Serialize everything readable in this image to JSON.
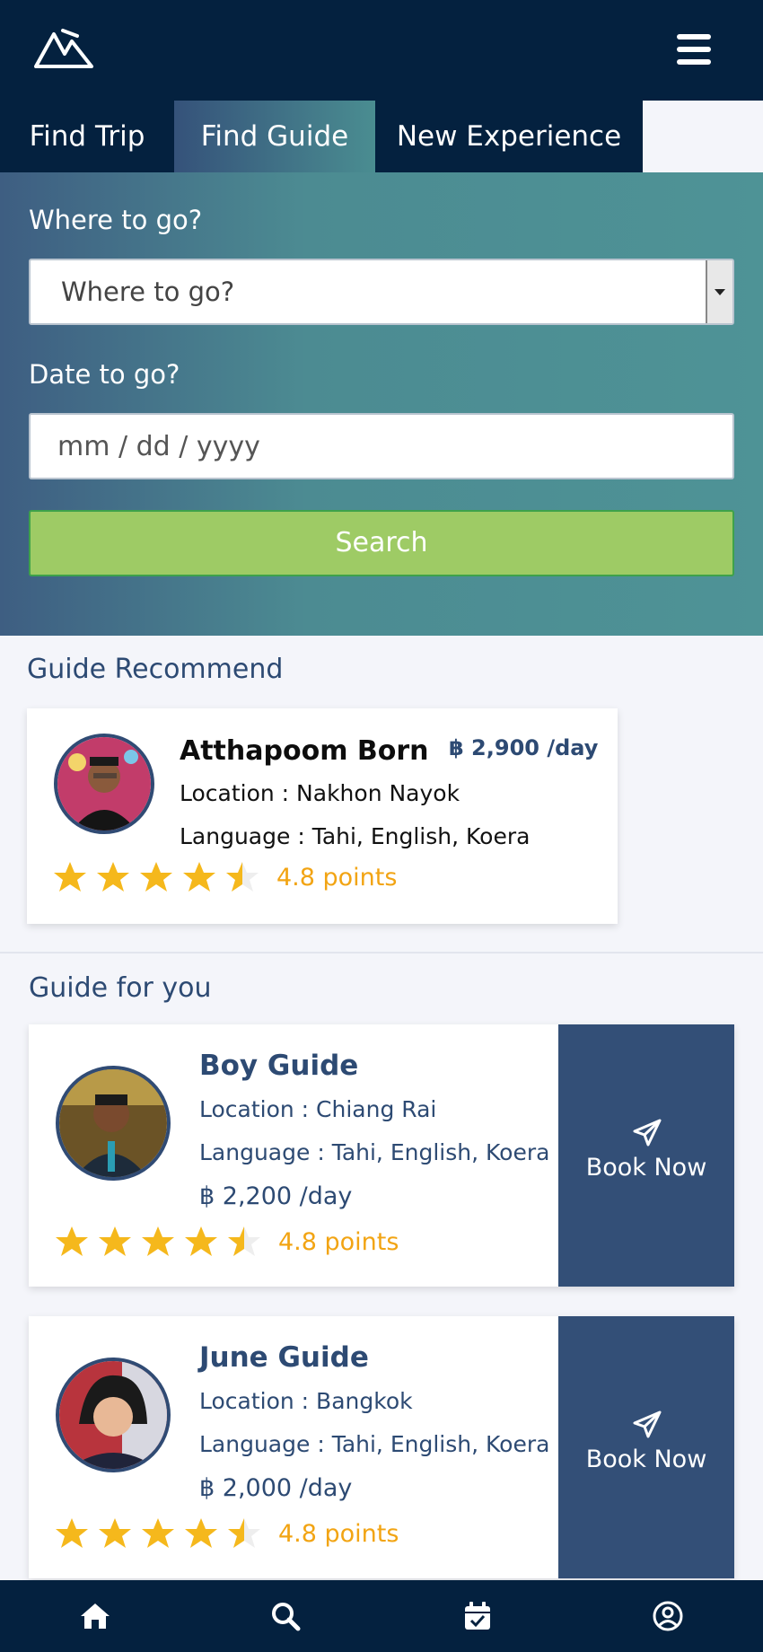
{
  "tabs": [
    {
      "label": "Find Trip",
      "active": false
    },
    {
      "label": "Find Guide",
      "active": true
    },
    {
      "label": "New Experience",
      "active": false
    }
  ],
  "search": {
    "where_label": "Where to go?",
    "where_value": "Where to go?",
    "date_label": "Date to go?",
    "date_placeholder": "mm / dd / yyyy",
    "button_label": "Search"
  },
  "recommend": {
    "title": "Guide Recommend",
    "name": "Atthapoom Born",
    "price": "฿ 2,900 /day",
    "location": "Location : Nakhon Nayok",
    "language": "Language : Tahi, English, Koera",
    "rating": 4.5,
    "points": "4.8 points"
  },
  "guides_title": "Guide for you",
  "guides": [
    {
      "name": "Boy Guide",
      "location": "Location : Chiang Rai",
      "language": "Language : Tahi, English, Koera",
      "price": "฿ 2,200 /day",
      "rating": 4.5,
      "points": "4.8 points",
      "book_label": "Book Now"
    },
    {
      "name": "June Guide",
      "location": "Location : Bangkok",
      "language": "Language : Tahi, English, Koera",
      "price": "฿ 2,000 /day",
      "rating": 4.5,
      "points": "4.8 points",
      "book_label": "Book Now"
    }
  ],
  "nav": [
    "home-icon",
    "search-icon",
    "calendar-check-icon",
    "user-circle-icon"
  ],
  "colors": {
    "navy": "#04213f",
    "accent": "#334f77",
    "star": "#f5b81c",
    "search": "#9ecb65"
  }
}
